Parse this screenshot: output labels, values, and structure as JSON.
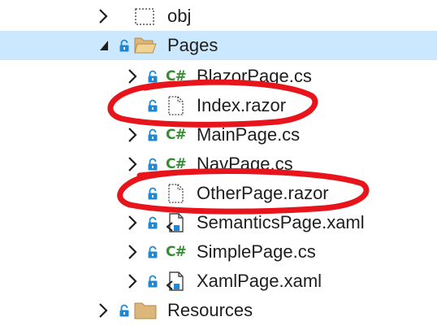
{
  "tree": {
    "items": [
      {
        "label": "obj",
        "icon": "dotted-folder-icon"
      },
      {
        "label": "Pages",
        "icon": "folder-open-icon"
      },
      {
        "label": "BlazorPage.cs",
        "icon": "csharp-file-icon",
        "icon_text": "C#"
      },
      {
        "label": "Index.razor",
        "icon": "razor-file-icon"
      },
      {
        "label": "MainPage.cs",
        "icon": "csharp-file-icon",
        "icon_text": "C#"
      },
      {
        "label": "NavPage.cs",
        "icon": "csharp-file-icon",
        "icon_text": "C#"
      },
      {
        "label": "OtherPage.razor",
        "icon": "razor-file-icon"
      },
      {
        "label": "SemanticsPage.xaml",
        "icon": "xaml-file-icon"
      },
      {
        "label": "SimplePage.cs",
        "icon": "csharp-file-icon",
        "icon_text": "C#"
      },
      {
        "label": "XamlPage.xaml",
        "icon": "xaml-file-icon"
      },
      {
        "label": "Resources",
        "icon": "folder-icon"
      }
    ]
  },
  "colors": {
    "selection": "#cce8ff",
    "csharp": "#388a34",
    "lock": "#1e88d2",
    "folder": "#dcb67a",
    "annotation": "#e8141c"
  }
}
